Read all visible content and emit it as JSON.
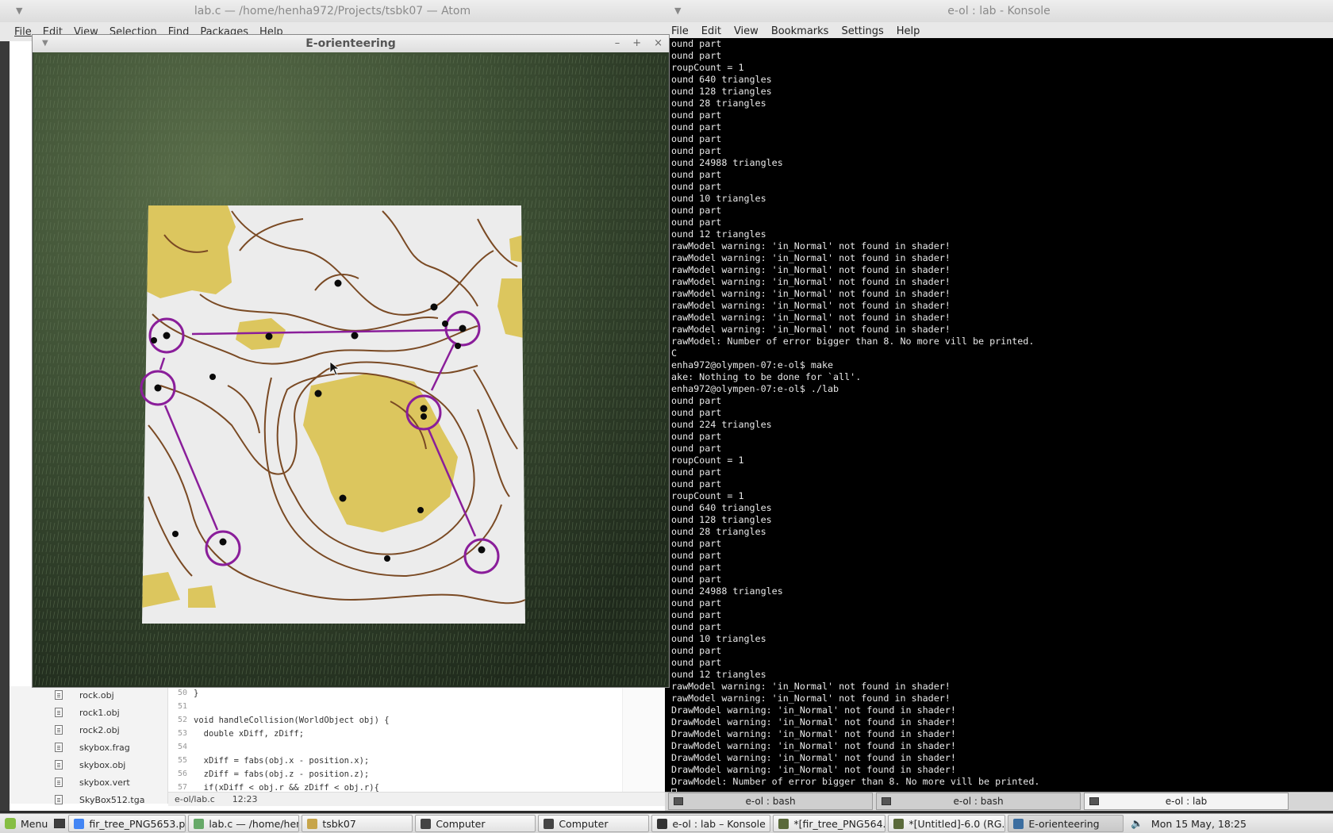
{
  "atom": {
    "title": "lab.c — /home/henha972/Projects/tsbk07 — Atom",
    "menu": [
      "File",
      "Edit",
      "View",
      "Selection",
      "Find",
      "Packages",
      "Help"
    ],
    "tree_items": [
      "rock.obj",
      "rock1.obj",
      "rock2.obj",
      "skybox.frag",
      "skybox.obj",
      "skybox.vert",
      "SkyBox512.tga"
    ],
    "code": [
      {
        "ln": "50",
        "text": "}"
      },
      {
        "ln": "51",
        "text": ""
      },
      {
        "ln": "52",
        "text": "void handleCollision(WorldObject obj) {"
      },
      {
        "ln": "53",
        "text": "  double xDiff, zDiff;"
      },
      {
        "ln": "54",
        "text": ""
      },
      {
        "ln": "55",
        "text": "  xDiff = fabs(obj.x - position.x);"
      },
      {
        "ln": "56",
        "text": "  zDiff = fabs(obj.z - position.z);"
      },
      {
        "ln": "57",
        "text": "  if(xDiff < obj.r && zDiff < obj.r){"
      }
    ],
    "status_path": "e-ol/lab.c",
    "status_pos": "12:23"
  },
  "konsole": {
    "title": "e-ol : lab - Konsole",
    "menu": [
      "File",
      "Edit",
      "View",
      "Bookmarks",
      "Settings",
      "Help"
    ],
    "lines": [
      "ound part",
      "ound part",
      "roupCount = 1",
      "ound 640 triangles",
      "ound 128 triangles",
      "ound 28 triangles",
      "ound part",
      "ound part",
      "ound part",
      "ound part",
      "ound 24988 triangles",
      "ound part",
      "ound part",
      "ound 10 triangles",
      "ound part",
      "ound part",
      "ound 12 triangles",
      "rawModel warning: 'in_Normal' not found in shader!",
      "rawModel warning: 'in_Normal' not found in shader!",
      "rawModel warning: 'in_Normal' not found in shader!",
      "rawModel warning: 'in_Normal' not found in shader!",
      "rawModel warning: 'in_Normal' not found in shader!",
      "rawModel warning: 'in_Normal' not found in shader!",
      "rawModel warning: 'in_Normal' not found in shader!",
      "rawModel warning: 'in_Normal' not found in shader!",
      "rawModel: Number of error bigger than 8. No more vill be printed.",
      "C",
      "enha972@olympen-07:e-ol$ make",
      "ake: Nothing to be done for `all'.",
      "enha972@olympen-07:e-ol$ ./lab",
      "ound part",
      "ound part",
      "ound 224 triangles",
      "ound part",
      "ound part",
      "roupCount = 1",
      "ound part",
      "ound part",
      "roupCount = 1",
      "ound 640 triangles",
      "ound 128 triangles",
      "ound 28 triangles",
      "ound part",
      "ound part",
      "ound part",
      "ound part",
      "ound 24988 triangles",
      "ound part",
      "ound part",
      "ound part",
      "ound 10 triangles",
      "ound part",
      "ound part",
      "ound 12 triangles",
      "rawModel warning: 'in_Normal' not found in shader!",
      "rawModel warning: 'in_Normal' not found in shader!",
      "DrawModel warning: 'in_Normal' not found in shader!",
      "DrawModel warning: 'in_Normal' not found in shader!",
      "DrawModel warning: 'in_Normal' not found in shader!",
      "DrawModel warning: 'in_Normal' not found in shader!",
      "DrawModel warning: 'in_Normal' not found in shader!",
      "DrawModel warning: 'in_Normal' not found in shader!",
      "DrawModel: Number of error bigger than 8. No more vill be printed."
    ],
    "tabs": [
      "e-ol : bash",
      "e-ol : bash",
      "e-ol : lab"
    ]
  },
  "eo": {
    "title": "E-orienteering",
    "controls": [
      "–",
      "+",
      "×"
    ]
  },
  "taskbar": {
    "menu_label": "Menu",
    "items": [
      {
        "label": "fir_tree_PNG5653.p...",
        "icon": "chrome-icon",
        "color": "#4285f4"
      },
      {
        "label": "lab.c — /home/hen...",
        "icon": "atom-icon",
        "color": "#66a968"
      },
      {
        "label": "tsbk07",
        "icon": "folder-icon",
        "color": "#c7a54a"
      },
      {
        "label": "Computer",
        "icon": "computer-icon",
        "color": "#444444"
      },
      {
        "label": "Computer",
        "icon": "computer-icon",
        "color": "#444444"
      },
      {
        "label": "e-ol : lab – Konsole",
        "icon": "terminal-icon",
        "color": "#333333"
      },
      {
        "label": "*[fir_tree_PNG564...",
        "icon": "gimp-icon",
        "color": "#5a6a3a"
      },
      {
        "label": "*[Untitled]-6.0 (RG...",
        "icon": "gimp-icon",
        "color": "#5a6a3a"
      },
      {
        "label": "E-orienteering",
        "icon": "window-icon",
        "color": "#3c6ea0"
      }
    ],
    "clock": "Mon 15 May, 18:25"
  }
}
